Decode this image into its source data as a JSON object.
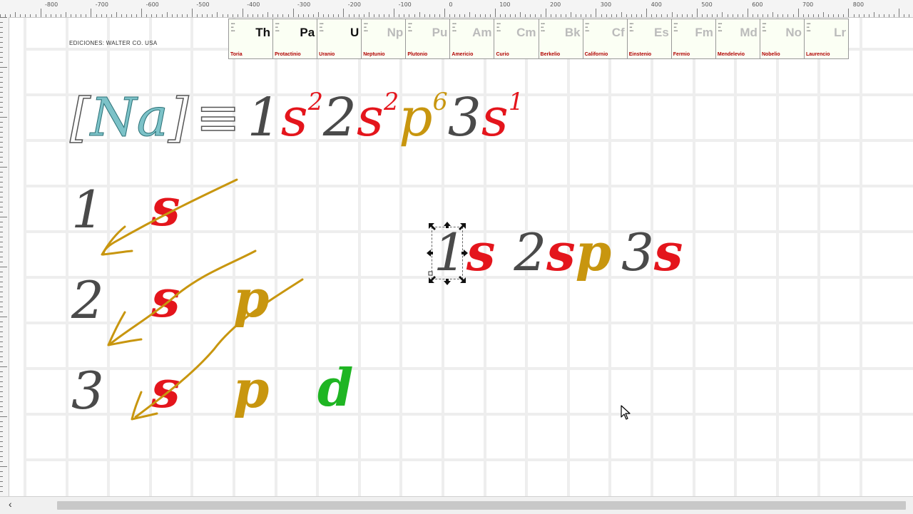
{
  "ruler": {
    "labels": [
      "-800",
      "-700",
      "-600",
      "-500",
      "-400",
      "-300",
      "-200",
      "-100",
      "0",
      "100",
      "200",
      "300",
      "400",
      "500",
      "600",
      "700",
      "800"
    ]
  },
  "publisher": "EDICIONES: WALTER CO. USA",
  "periodic_strip": [
    {
      "symbol": "Th",
      "name": "Toria",
      "color": "#111111"
    },
    {
      "symbol": "Pa",
      "name": "Protactinio",
      "color": "#111111"
    },
    {
      "symbol": "U",
      "name": "Uranio",
      "color": "#111111"
    },
    {
      "symbol": "Np",
      "name": "Neptunio",
      "color": "#bbbbbb"
    },
    {
      "symbol": "Pu",
      "name": "Plutonio",
      "color": "#bbbbbb"
    },
    {
      "symbol": "Am",
      "name": "Americio",
      "color": "#bbbbbb"
    },
    {
      "symbol": "Cm",
      "name": "Curio",
      "color": "#bbbbbb"
    },
    {
      "symbol": "Bk",
      "name": "Berkelio",
      "color": "#bbbbbb"
    },
    {
      "symbol": "Cf",
      "name": "Californio",
      "color": "#bbbbbb"
    },
    {
      "symbol": "Es",
      "name": "Einstenio",
      "color": "#bbbbbb"
    },
    {
      "symbol": "Fm",
      "name": "Fermio",
      "color": "#bbbbbb"
    },
    {
      "symbol": "Md",
      "name": "Mendelevio",
      "color": "#bbbbbb"
    },
    {
      "symbol": "No",
      "name": "Nobelio",
      "color": "#bbbbbb"
    },
    {
      "symbol": "Lr",
      "name": "Laurencio",
      "color": "#bbbbbb"
    }
  ],
  "config": {
    "element": "Na",
    "equiv": "≡",
    "parts": [
      {
        "n": "1",
        "l": "s",
        "e": "2"
      },
      {
        "n": "2",
        "l": "s",
        "e": "2"
      },
      {
        "n": "",
        "l": "p",
        "e": "6"
      },
      {
        "n": "3",
        "l": "s",
        "e": "1"
      }
    ]
  },
  "diagram": {
    "rows": [
      {
        "n": "1",
        "orbitals": [
          "s"
        ]
      },
      {
        "n": "2",
        "orbitals": [
          "s",
          "p"
        ]
      },
      {
        "n": "3",
        "orbitals": [
          "s",
          "p",
          "d"
        ]
      }
    ]
  },
  "sequence": {
    "n1": "1",
    "s1": "s",
    "n2": "2",
    "s2": "s",
    "p2": "p",
    "n3": "3",
    "s3": "s"
  },
  "colors": {
    "s": "#e4151c",
    "p": "#c8960f",
    "d": "#1fb523",
    "number": "#4a4a4a",
    "arrow": "#c8960f",
    "element": "#6fb3b8"
  },
  "scrollbar": {
    "left_arrow": "‹"
  }
}
